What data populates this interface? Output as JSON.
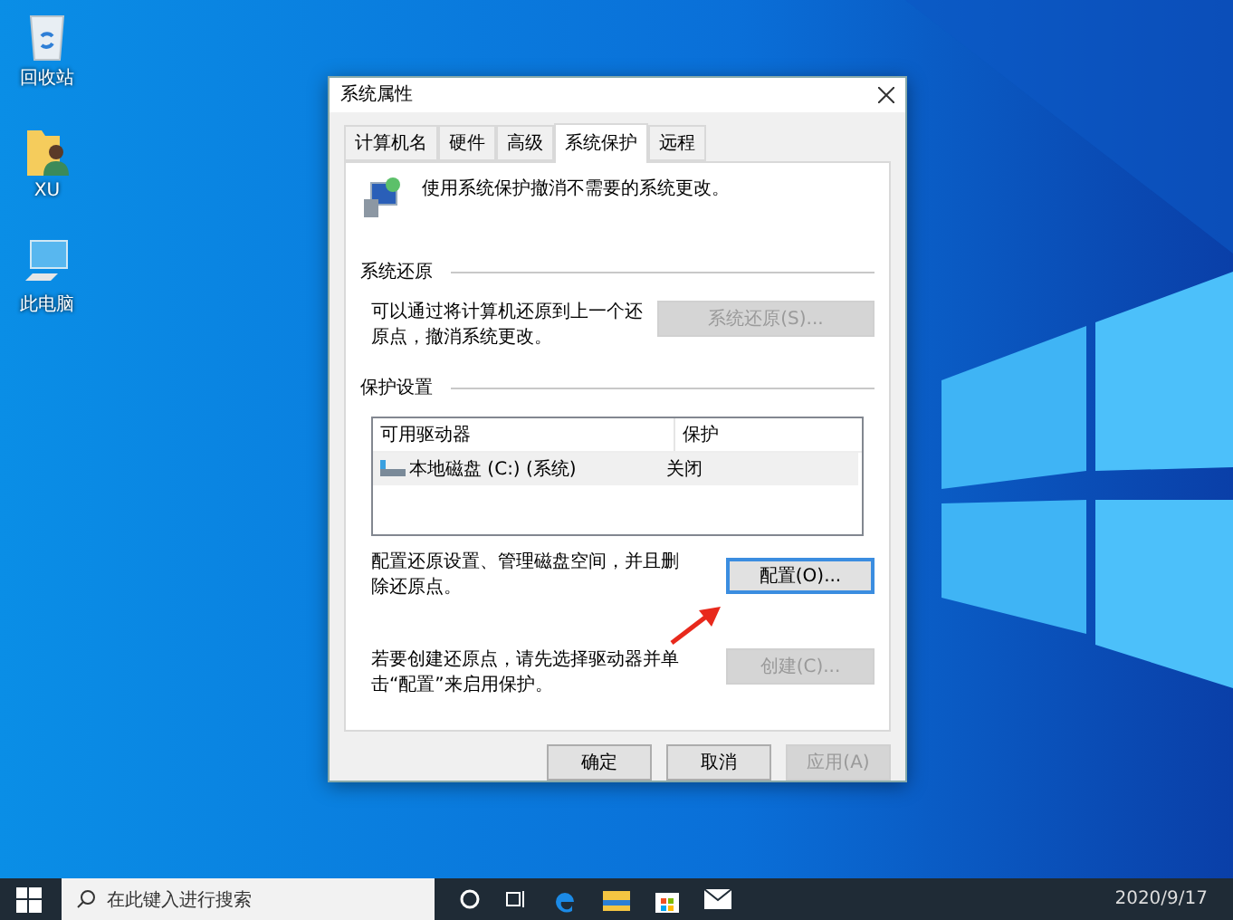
{
  "desktop_icons": [
    {
      "kind": "recycle",
      "label": "回收站"
    },
    {
      "kind": "user",
      "label": "XU"
    },
    {
      "kind": "computer",
      "label": "此电脑"
    }
  ],
  "dialog": {
    "title": "系统属性",
    "tabs": [
      {
        "label": "计算机名",
        "selected": false
      },
      {
        "label": "硬件",
        "selected": false
      },
      {
        "label": "高级",
        "selected": false
      },
      {
        "label": "系统保护",
        "selected": true
      },
      {
        "label": "远程",
        "selected": false
      }
    ],
    "intro": "使用系统保护撤消不需要的系统更改。",
    "restore": {
      "heading": "系统还原",
      "text": "可以通过将计算机还原到上一个还原点，撤消系统更改。",
      "button": {
        "label": "系统还原(S)...",
        "disabled": true
      }
    },
    "protection": {
      "heading": "保护设置",
      "columns": [
        "可用驱动器",
        "保护"
      ],
      "rows": [
        {
          "drive": "本地磁盘 (C:) (系统)",
          "protection": "关闭",
          "selected": true
        }
      ],
      "configure_text": "配置还原设置、管理磁盘空间，并且删除还原点。",
      "configure_button": {
        "label": "配置(O)...",
        "disabled": false,
        "focused": true
      },
      "create_text": "若要创建还原点，请先选择驱动器并单击“配置”来启用保护。",
      "create_button": {
        "label": "创建(C)...",
        "disabled": true
      }
    },
    "buttons": [
      {
        "label": "确定",
        "disabled": false
      },
      {
        "label": "取消",
        "disabled": false
      },
      {
        "label": "应用(A)",
        "disabled": true
      }
    ]
  },
  "taskbar": {
    "search_placeholder": "在此键入进行搜索",
    "date": "2020/9/17"
  }
}
